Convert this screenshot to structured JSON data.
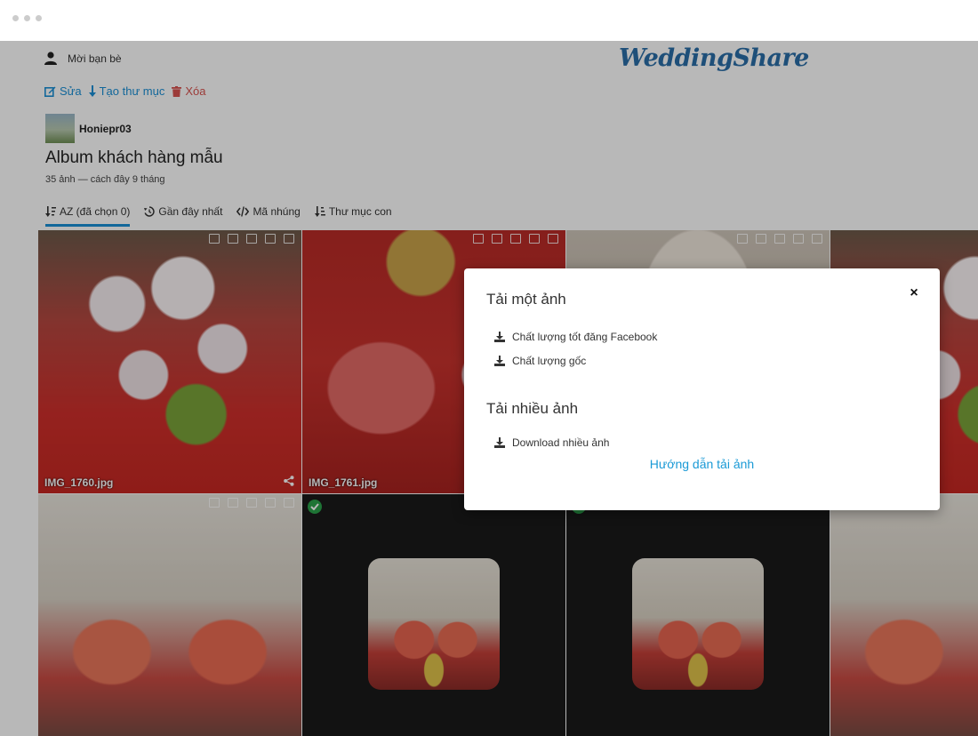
{
  "header": {
    "invite_label": "Mời bạn bè",
    "logo_text": "WeddingShare"
  },
  "actions": {
    "edit_label": "Sửa",
    "create_folder_label": "Tạo thư mục",
    "delete_label": "Xóa"
  },
  "album": {
    "owner": "Honiepr03",
    "title": "Album khách hàng mẫu",
    "meta": "35 ảnh — cách đây 9 tháng"
  },
  "tabs": [
    {
      "label": "AZ (đã chọn 0)",
      "icon": "sort-icon",
      "active": true
    },
    {
      "label": "Gần đây nhất",
      "icon": "history-icon",
      "active": false
    },
    {
      "label": "Mã nhúng",
      "icon": "code-icon",
      "active": false
    },
    {
      "label": "Thư mục con",
      "icon": "sort-icon",
      "active": false
    }
  ],
  "photos": [
    {
      "filename": "IMG_1760.jpg",
      "selected": false
    },
    {
      "filename": "IMG_1761.jpg",
      "selected": false
    },
    {
      "filename": "",
      "selected": false
    },
    {
      "filename": "",
      "selected": false
    },
    {
      "filename": "",
      "selected": false
    },
    {
      "filename": "",
      "selected": true
    },
    {
      "filename": "",
      "selected": true
    },
    {
      "filename": "",
      "selected": false
    }
  ],
  "modal": {
    "single_title": "Tải một ảnh",
    "option_facebook": "Chất lượng tốt đăng Facebook",
    "option_original": "Chất lượng gốc",
    "multi_title": "Tải nhiều ảnh",
    "option_multi": "Download nhiều ảnh",
    "guide_link": "Hướng dẫn tải ảnh",
    "close_symbol": "×"
  },
  "colors": {
    "accent": "#1a8fd6",
    "danger": "#d9534f",
    "check": "#2aa14a",
    "logo": "#2a6ea8"
  }
}
